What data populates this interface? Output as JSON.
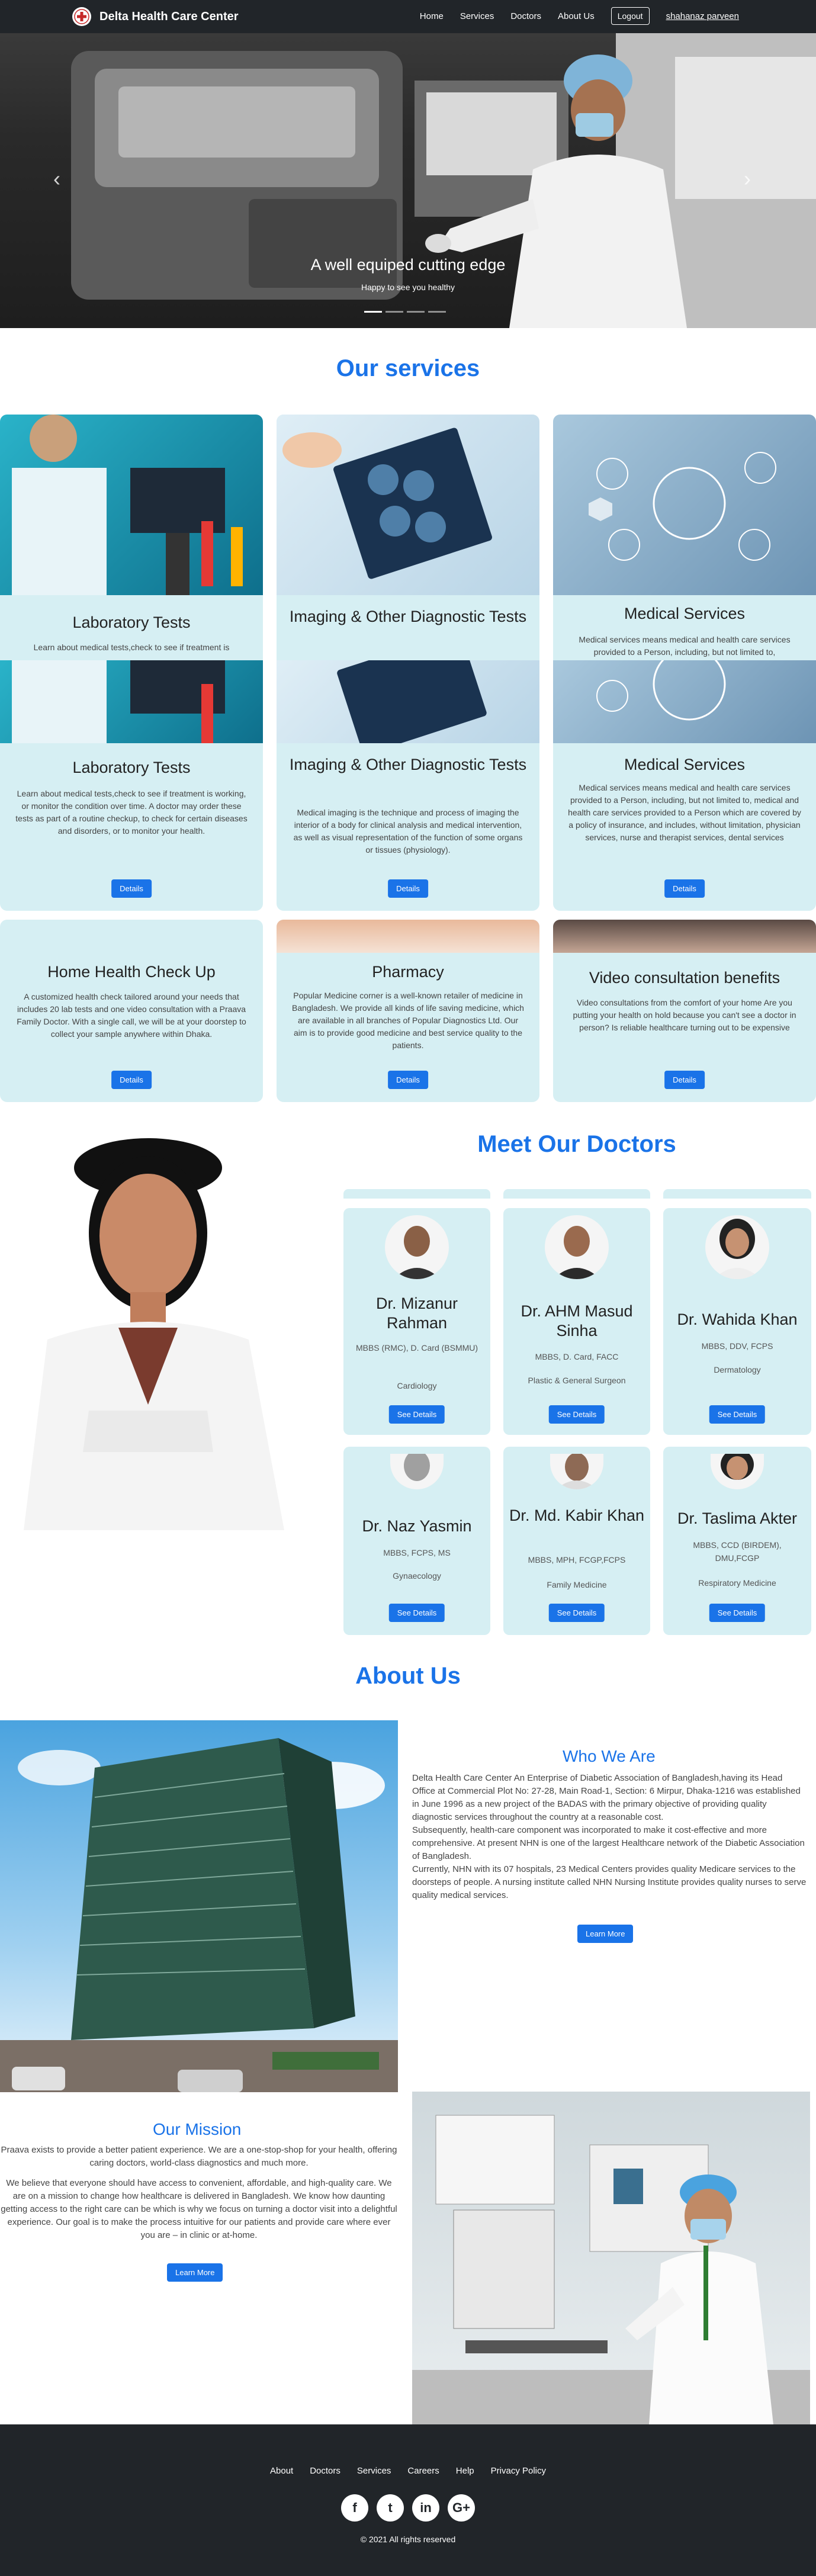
{
  "nav": {
    "brand": "Delta Health Care Center",
    "links": [
      "Home",
      "Services",
      "Doctors",
      "About Us"
    ],
    "logout": "Logout",
    "user": "shahanaz parveen"
  },
  "hero": {
    "title": "A well equiped cutting edge",
    "subtitle": "Happy to see you healthy",
    "prev": "‹",
    "next": "›",
    "slides": 4,
    "active_slide": 1
  },
  "services": {
    "title": "Our services",
    "overlay_row": [
      {
        "title": "Laboratory Tests",
        "text": "Learn about medical tests,check to see if treatment is"
      },
      {
        "title": "Imaging & Other Diagnostic Tests",
        "text": ""
      },
      {
        "title": "Medical Services",
        "text": "Medical services means medical and health care services provided to a Person, including, but not limited to,"
      }
    ],
    "cards": [
      {
        "title": "Laboratory Tests",
        "text": "Learn about medical tests,check to see if treatment is working, or monitor the condition over time. A doctor may order these tests as part of a routine checkup, to check for certain diseases and disorders, or to monitor your health.",
        "button": "Details"
      },
      {
        "title": "Imaging & Other Diagnostic Tests",
        "text": "Medical imaging is the technique and process of imaging the interior of a body for clinical analysis and medical intervention, as well as visual representation of the function of some organs or tissues (physiology).",
        "button": "Details"
      },
      {
        "title": "Medical Services",
        "text": "Medical services means medical and health care services provided to a Person, including, but not limited to, medical and health care services provided to a Person which are covered by a policy of insurance, and includes, without limitation, physician services, nurse and therapist services, dental services",
        "button": "Details"
      },
      {
        "title": "Home Health Check Up",
        "text": "A customized health check tailored around your needs that includes 20 lab tests and one video consultation with a Praava Family Doctor. With a single call, we will be at your doorstep to collect your sample anywhere within Dhaka.",
        "button": "Details"
      },
      {
        "title": "Pharmacy",
        "text": "Popular Medicine corner is a well-known retailer of medicine in Bangladesh. We provide all kinds of life saving medicine, which are available in all branches of Popular Diagnostics Ltd. Our aim is to provide good medicine and best service quality to the patients.",
        "button": "Details"
      },
      {
        "title": "Video consultation benefits",
        "text": "Video consultations from the comfort of your home Are you putting your health on hold because you can't see a doctor in person? Is reliable healthcare turning out to be expensive",
        "button": "Details"
      }
    ]
  },
  "doctors": {
    "title": "Meet Our Doctors",
    "list": [
      {
        "name": "Dr. Mizanur Rahman",
        "degree": "MBBS (RMC), D. Card (BSMMU)",
        "specialty": "Cardiology",
        "button": "See Details"
      },
      {
        "name": "Dr. AHM Masud Sinha",
        "degree": "MBBS, D. Card, FACC",
        "specialty": "Plastic & General Surgeon",
        "button": "See Details"
      },
      {
        "name": "Dr. Wahida Khan",
        "degree": "MBBS, DDV, FCPS",
        "specialty": "Dermatology",
        "button": "See Details"
      },
      {
        "name": "Dr. Naz Yasmin",
        "degree": "MBBS, FCPS, MS",
        "specialty": "Gynaecology",
        "button": "See Details"
      },
      {
        "name": "Dr. Md. Kabir Khan",
        "degree": "MBBS, MPH, FCGP,FCPS",
        "specialty": "Family Medicine",
        "button": "See Details"
      },
      {
        "name": "Dr. Taslima Akter",
        "degree": "MBBS, CCD (BIRDEM), DMU,FCGP",
        "specialty": "Respiratory Medicine",
        "button": "See Details"
      }
    ]
  },
  "about": {
    "title": "About Us",
    "who_title": "Who We Are",
    "who_p1": "Delta Health Care Center An Enterprise of Diabetic Association of Bangladesh,having its Head Office at Commercial Plot No: 27-28, Main Road-1, Section: 6 Mirpur, Dhaka-1216 was established in June 1996 as a new project of the BADAS with the primary objective of providing quality diagnostic services throughout the country at a reasonable cost.",
    "who_p2": "Subsequently, health-care component was incorporated to make it cost-effective and more comprehensive. At present NHN is one of the largest Healthcare network of the Diabetic Association of Bangladesh.",
    "who_p3": "Currently, NHN with its 07 hospitals, 23 Medical Centers provides quality Medicare services to the doorsteps of people. A nursing institute called NHN Nursing Institute provides quality nurses to serve quality medical services.",
    "who_button": "Learn More",
    "mission_title": "Our Mission",
    "mission_p1": "Praava exists to provide a better patient experience. We are a one-stop-shop for your health, offering caring doctors, world-class diagnostics and much more.",
    "mission_p2": "We believe that everyone should have access to convenient, affordable, and high-quality care. We are on a mission to change how healthcare is delivered in Bangladesh. We know how daunting getting access to the right care can be which is why we focus on turning a doctor visit into a delightful experience. Our goal is to make the process intuitive for our patients and provide care where ever you are – in clinic or at-home.",
    "mission_button": "Learn More"
  },
  "footer": {
    "links": [
      "About",
      "Doctors",
      "Services",
      "Careers",
      "Help",
      "Privacy Policy"
    ],
    "social": [
      {
        "icon": "facebook-icon",
        "glyph": "f"
      },
      {
        "icon": "twitter-icon",
        "glyph": "t"
      },
      {
        "icon": "linkedin-icon",
        "glyph": "in"
      },
      {
        "icon": "google-plus-icon",
        "glyph": "G+"
      }
    ],
    "copyright": "© 2021 All rights reserved"
  },
  "colors": {
    "accent": "#1a73e8",
    "card_bg": "#d6eff3",
    "dark": "#212529"
  }
}
